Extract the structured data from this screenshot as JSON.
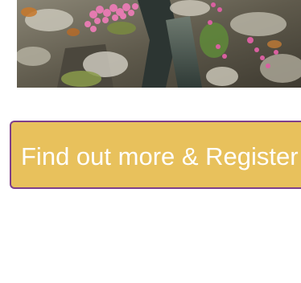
{
  "hero": {
    "image_name": "rocky-coast-sea-pinks-photo"
  },
  "cta": {
    "label": "Find out more & Register"
  },
  "colors": {
    "button_fill": "#e8c15c",
    "button_border": "#7e3f8c",
    "button_text": "#ffffff"
  }
}
